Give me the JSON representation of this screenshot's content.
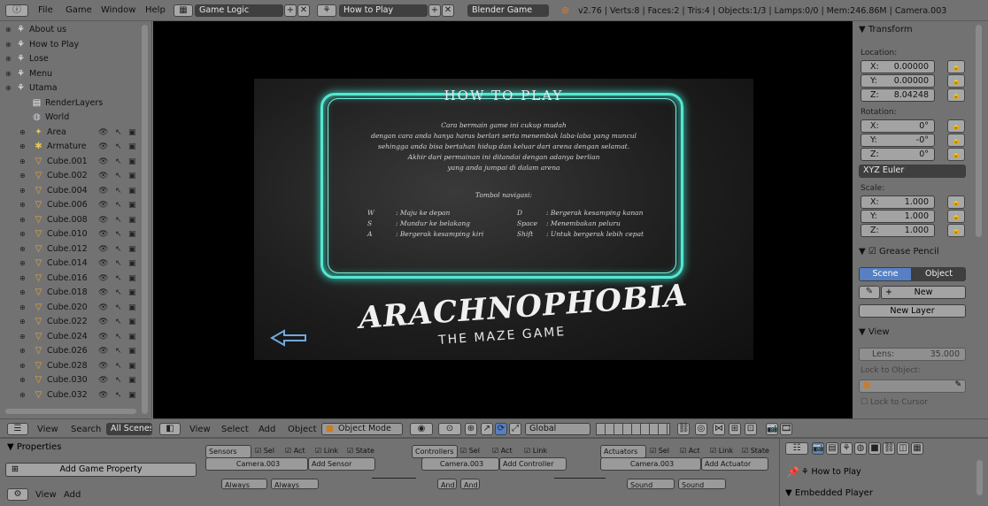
{
  "top_menu": {
    "items": [
      "File",
      "Game",
      "Window",
      "Help"
    ],
    "screen_layout": "Game Logic",
    "scene": "How to Play",
    "engine": "Blender Game",
    "stats": "v2.76 | Verts:8 | Faces:2 | Tris:4 | Objects:1/3 | Lamps:0/0 | Mem:246.86M | Camera.003"
  },
  "outliner": {
    "rows": [
      {
        "label": "About us",
        "icon": "scene-icon"
      },
      {
        "label": "How to Play",
        "icon": "scene-icon"
      },
      {
        "label": "Lose",
        "icon": "scene-icon"
      },
      {
        "label": "Menu",
        "icon": "scene-icon"
      },
      {
        "label": "Utama",
        "icon": "scene-icon"
      },
      {
        "label": "RenderLayers",
        "icon": "renderlayer-icon"
      },
      {
        "label": "World",
        "icon": "world-icon"
      },
      {
        "label": "Area",
        "icon": "lamp-icon"
      },
      {
        "label": "Armature",
        "icon": "armature-icon"
      },
      {
        "label": "Cube.001",
        "icon": "mesh-icon"
      },
      {
        "label": "Cube.002",
        "icon": "mesh-icon"
      },
      {
        "label": "Cube.004",
        "icon": "mesh-icon"
      },
      {
        "label": "Cube.006",
        "icon": "mesh-icon"
      },
      {
        "label": "Cube.008",
        "icon": "mesh-icon"
      },
      {
        "label": "Cube.010",
        "icon": "mesh-icon"
      },
      {
        "label": "Cube.012",
        "icon": "mesh-icon"
      },
      {
        "label": "Cube.014",
        "icon": "mesh-icon"
      },
      {
        "label": "Cube.016",
        "icon": "mesh-icon"
      },
      {
        "label": "Cube.018",
        "icon": "mesh-icon"
      },
      {
        "label": "Cube.020",
        "icon": "mesh-icon"
      },
      {
        "label": "Cube.022",
        "icon": "mesh-icon"
      },
      {
        "label": "Cube.024",
        "icon": "mesh-icon"
      },
      {
        "label": "Cube.026",
        "icon": "mesh-icon"
      },
      {
        "label": "Cube.028",
        "icon": "mesh-icon"
      },
      {
        "label": "Cube.030",
        "icon": "mesh-icon"
      },
      {
        "label": "Cube.032",
        "icon": "mesh-icon"
      }
    ],
    "footer": {
      "view": "View",
      "search": "Search",
      "all_scenes": "All Scenes"
    }
  },
  "game_screen": {
    "title": "HOW TO PLAY",
    "lines": [
      "Cara bermain game ini cukup mudah",
      "dengan cara anda hanya harus berlari serta menembak laba-laba yang muncul",
      "sehingga anda bisa bertahan hidup dan keluar dari arena dengan selamat.",
      "Akhir dari permainan ini ditandai dengan adanya berlian",
      "yang anda jumpai di dalam arena"
    ],
    "keys_title": "Tombol navigasi:",
    "keys": [
      {
        "k1": "W",
        "d1": ": Maju ke depan",
        "k2": "D",
        "d2": ": Bergerak kesamping kanan"
      },
      {
        "k1": "S",
        "d1": ": Mundur ke belakang",
        "k2": "Space",
        "d2": ": Menembakan peluru"
      },
      {
        "k1": "A",
        "d1": ": Bergerak kesamping kiri",
        "k2": "Shift",
        "d2": ": Untuk bergerak lebih cepat"
      }
    ],
    "logo": "ARACHNOPHOBIA",
    "logo_sub": "THE MAZE GAME"
  },
  "viewport_header": {
    "view": "View",
    "select": "Select",
    "add": "Add",
    "object": "Object",
    "mode": "Object Mode",
    "orientation": "Global"
  },
  "properties": {
    "transform": "Transform",
    "location_label": "Location:",
    "location": [
      {
        "axis": "X:",
        "value": "0.00000"
      },
      {
        "axis": "Y:",
        "value": "0.00000"
      },
      {
        "axis": "Z:",
        "value": "8.04248"
      }
    ],
    "rotation_label": "Rotation:",
    "rotation": [
      {
        "axis": "X:",
        "value": "0°"
      },
      {
        "axis": "Y:",
        "value": "-0°"
      },
      {
        "axis": "Z:",
        "value": "0°"
      }
    ],
    "rotation_mode": "XYZ Euler",
    "scale_label": "Scale:",
    "scale": [
      {
        "axis": "X:",
        "value": "1.000"
      },
      {
        "axis": "Y:",
        "value": "1.000"
      },
      {
        "axis": "Z:",
        "value": "1.000"
      }
    ],
    "grease_pencil": "Grease Pencil",
    "gp_scene": "Scene",
    "gp_object": "Object",
    "gp_new": "New",
    "gp_new_layer": "New Layer",
    "view": "View",
    "lens_label": "Lens:",
    "lens": "35.000",
    "lock_to_object": "Lock to Object:",
    "lock_to_cursor": "Lock to Cursor"
  },
  "logic": {
    "properties_title": "Properties",
    "add_game_property": "Add Game Property",
    "view": "View",
    "add": "Add",
    "sensors": "Sensors",
    "controllers": "Controllers",
    "actuators": "Actuators",
    "sel": "Sel",
    "act": "Act",
    "link": "Link",
    "state": "State",
    "camera": "Camera.003",
    "add_sensor": "Add Sensor",
    "add_controller": "Add Controller",
    "add_actuator": "Add Actuator",
    "always": "Always",
    "and": "And",
    "sound": "Sound"
  },
  "right_bottom": {
    "scene": "How to Play",
    "embedded_player": "Embedded Player"
  }
}
